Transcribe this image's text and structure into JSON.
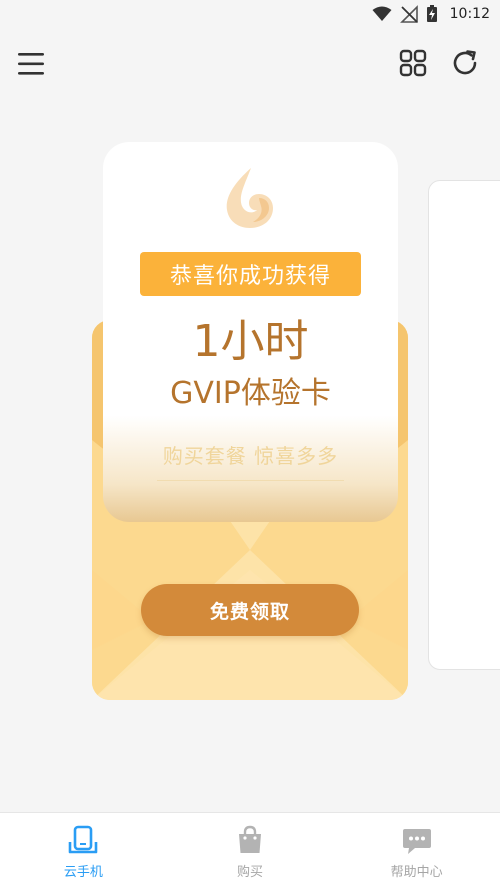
{
  "status_bar": {
    "time": "10:12",
    "icons": [
      "wifi-icon",
      "no-signal-icon",
      "battery-charging-icon"
    ]
  },
  "toolbar": {
    "menu_icon": "menu-icon",
    "grid_icon": "apps-grid-icon",
    "refresh_icon": "refresh-icon"
  },
  "reward_card": {
    "logo_icon": "flame-logo-icon",
    "banner_text": "恭喜你成功获得",
    "duration": "1小时",
    "card_name": "GVIP体验卡",
    "slogan": "购买套餐 惊喜多多",
    "claim_label": "免费领取"
  },
  "bottom_nav": {
    "items": [
      {
        "label": "云手机",
        "icon": "phone-icon",
        "active": true
      },
      {
        "label": "购买",
        "icon": "shopping-bag-icon",
        "active": false
      },
      {
        "label": "帮助中心",
        "icon": "chat-bubble-icon",
        "active": false
      }
    ]
  },
  "colors": {
    "accent_blue": "#2a9df4",
    "banner_orange": "#fbb23a",
    "title_brown": "#b5742d",
    "button_brown": "#d38a3a",
    "envelope_yellow": "#fde1a2"
  }
}
